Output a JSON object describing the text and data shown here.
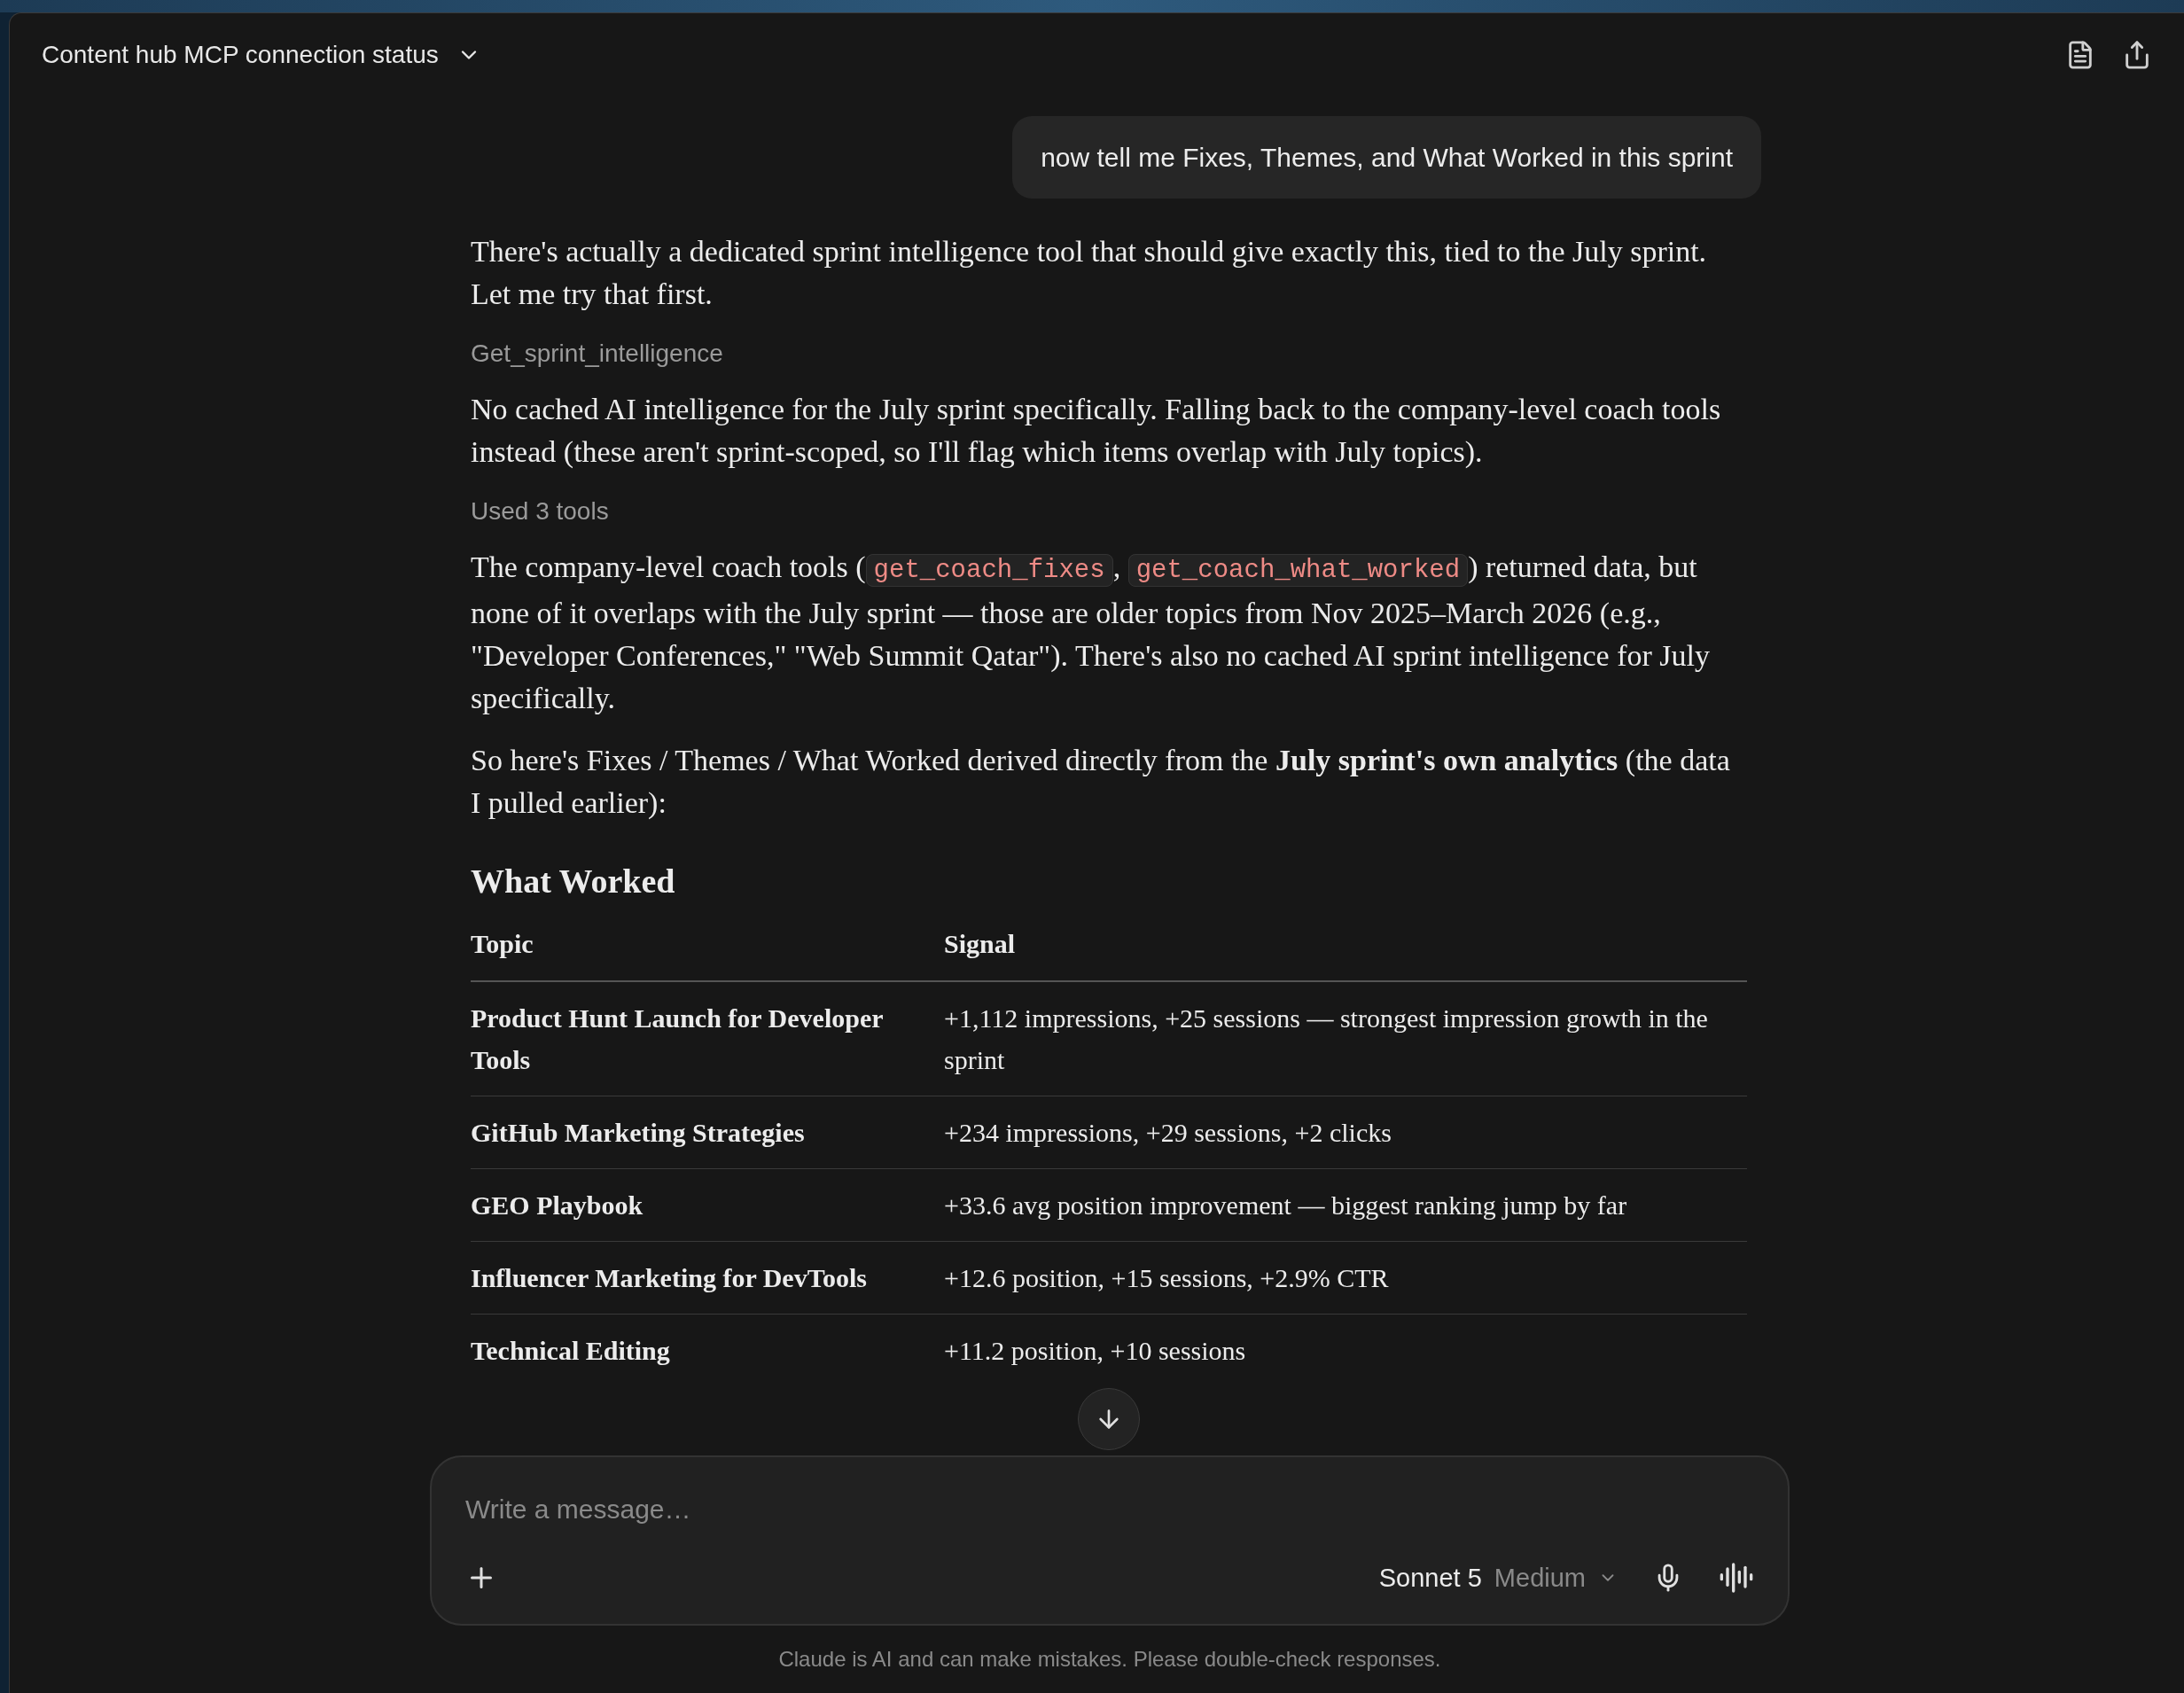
{
  "header": {
    "title": "Content hub MCP connection status"
  },
  "user_message": "now tell me Fixes, Themes, and What Worked in this sprint",
  "blocks": [
    {
      "kind": "paragraph",
      "parts": [
        {
          "kind": "text",
          "text": "There's actually a dedicated sprint intelligence tool that should give exactly this, tied to the July sprint. Let me try that first."
        }
      ]
    },
    {
      "kind": "tool",
      "text": "Get_sprint_intelligence"
    },
    {
      "kind": "paragraph",
      "parts": [
        {
          "kind": "text",
          "text": "No cached AI intelligence for the July sprint specifically. Falling back to the company-level coach tools instead (these aren't sprint-scoped, so I'll flag which items overlap with July topics)."
        }
      ]
    },
    {
      "kind": "tool",
      "text": "Used 3 tools"
    },
    {
      "kind": "paragraph",
      "parts": [
        {
          "kind": "text",
          "text": "The company-level coach tools ("
        },
        {
          "kind": "code",
          "text": "get_coach_fixes"
        },
        {
          "kind": "text",
          "text": ", "
        },
        {
          "kind": "code",
          "text": "get_coach_what_worked"
        },
        {
          "kind": "text",
          "text": ") returned data, but none of it overlaps with the July sprint — those are older topics from Nov 2025–March 2026 (e.g., \"Developer Conferences,\" \"Web Summit Qatar\"). There's also no cached AI sprint intelligence for July specifically."
        }
      ]
    },
    {
      "kind": "paragraph",
      "parts": [
        {
          "kind": "text",
          "text": "So here's Fixes / Themes / What Worked derived directly from the **July sprint's own analytics** (the data I pulled earlier):"
        }
      ]
    },
    {
      "kind": "heading",
      "text": "What Worked"
    },
    {
      "kind": "table",
      "columns": [
        "Topic",
        "Signal"
      ],
      "rows": [
        [
          "Product Hunt Launch for Developer Tools",
          "+1,112 impressions, +25 sessions — strongest impression growth in the sprint"
        ],
        [
          "GitHub Marketing Strategies",
          "+234 impressions, +29 sessions, +2 clicks"
        ],
        [
          "GEO Playbook",
          "+33.6 avg position improvement — biggest ranking jump by far"
        ],
        [
          "Influencer Marketing for DevTools",
          "+12.6 position, +15 sessions, +2.9% CTR"
        ],
        [
          "Technical Editing",
          "+11.2 position, +10 sessions"
        ]
      ]
    }
  ],
  "composer": {
    "placeholder": "Write a message…",
    "model": "Sonnet 5",
    "effort": "Medium"
  },
  "disclaimer": "Claude is AI and can make mistakes. Please double-check responses."
}
